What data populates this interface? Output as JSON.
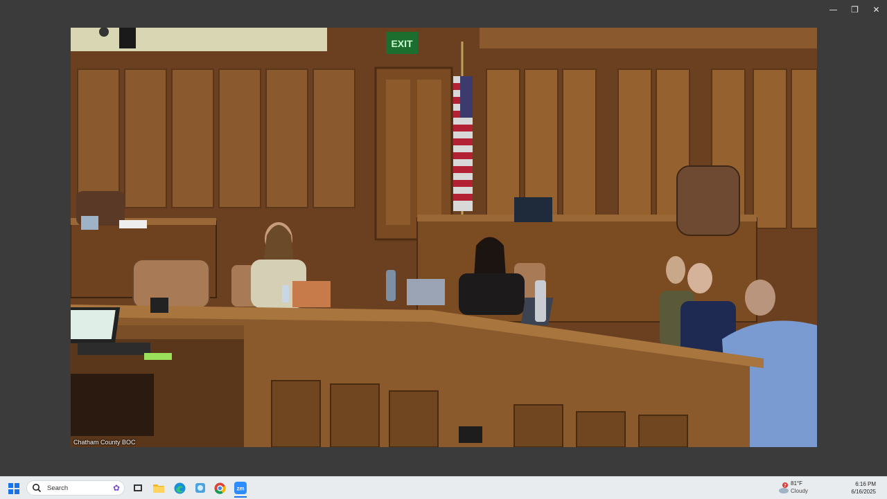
{
  "window": {
    "controls": {
      "minimize": "—",
      "restore": "❐",
      "close": "✕"
    }
  },
  "video": {
    "caption": "Chatham County BOC",
    "exit_sign": "EXIT"
  },
  "taskbar": {
    "search_placeholder": "Search",
    "pinned": [
      "file-explorer-icon",
      "edge-icon",
      "app-icon",
      "chrome-icon",
      "zoom-icon"
    ],
    "zoom_label": "zm",
    "weather": {
      "temp": "81°F",
      "condition": "Cloudy",
      "alert": "7"
    },
    "clock": {
      "time": "6:16 PM",
      "date": "6/16/2025"
    }
  },
  "colors": {
    "accent": "#1a73e8",
    "wood_dark": "#5a3419",
    "wood_mid": "#8a5a30",
    "wood_light": "#b07c46"
  }
}
